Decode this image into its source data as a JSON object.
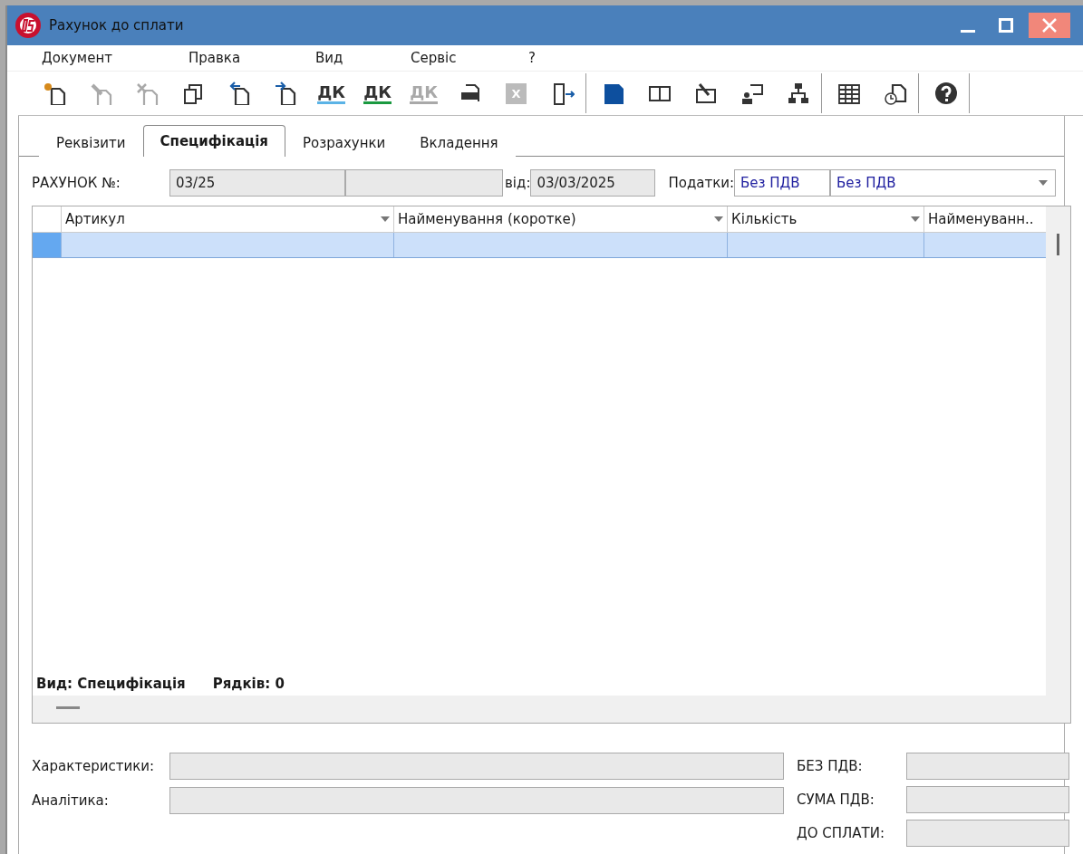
{
  "window": {
    "title": "Рахунок до сплати"
  },
  "menu": [
    "Документ",
    "Правка",
    "Вид",
    "Сервіс",
    "?"
  ],
  "toolbar": [
    {
      "kind": "new",
      "disabled": false
    },
    {
      "kind": "edit",
      "disabled": true
    },
    {
      "kind": "delete",
      "disabled": true
    },
    {
      "kind": "copy",
      "disabled": false
    },
    {
      "kind": "import-left",
      "disabled": false
    },
    {
      "kind": "import-right",
      "disabled": false
    },
    {
      "kind": "dk-line",
      "disabled": false,
      "text": "ДК"
    },
    {
      "kind": "dk-up",
      "disabled": false,
      "text": "ДК"
    },
    {
      "kind": "dk-down",
      "disabled": true,
      "text": "ДК"
    },
    {
      "kind": "print",
      "disabled": false
    },
    {
      "kind": "excel",
      "disabled": true,
      "text": "X"
    },
    {
      "kind": "exit",
      "disabled": false
    },
    {
      "kind": "separator"
    },
    {
      "kind": "save",
      "disabled": false
    },
    {
      "kind": "book",
      "disabled": false
    },
    {
      "kind": "edit-doc",
      "disabled": false
    },
    {
      "kind": "person",
      "disabled": false
    },
    {
      "kind": "tree",
      "disabled": false
    },
    {
      "kind": "separator"
    },
    {
      "kind": "table",
      "disabled": false
    },
    {
      "kind": "clock-doc",
      "disabled": false
    },
    {
      "kind": "separator"
    },
    {
      "kind": "help",
      "disabled": false
    },
    {
      "kind": "separator"
    }
  ],
  "tabs": [
    {
      "label": "Реквізити",
      "selected": false
    },
    {
      "label": "Специфікація",
      "selected": true
    },
    {
      "label": "Розрахунки",
      "selected": false
    },
    {
      "label": "Вкладення",
      "selected": false
    }
  ],
  "header": {
    "number_label": "РАХУНОК №:",
    "number": "03/25",
    "date_label": "від:",
    "date": "03/03/2025",
    "taxes_label": "Податки:",
    "tax_code": "Без ПДВ",
    "tax_name": "Без ПДВ"
  },
  "grid": {
    "columns": [
      {
        "label": "Артикул",
        "filter": true
      },
      {
        "label": "Найменування (коротке)",
        "filter": true
      },
      {
        "label": "Кількість",
        "filter": true
      },
      {
        "label": "Найменуванн..",
        "filter": false
      }
    ],
    "rows": [
      {
        "selected": true
      }
    ],
    "status": [
      "Вид: Специфікація",
      "Рядків: 0"
    ]
  },
  "details": [
    {
      "label": "Характеристики:"
    },
    {
      "label": "Аналітика:"
    }
  ],
  "totals": [
    {
      "label": "БЕЗ ПДВ:"
    },
    {
      "label": "СУМА ПДВ:"
    },
    {
      "label": "ДО СПЛАТИ:"
    }
  ]
}
